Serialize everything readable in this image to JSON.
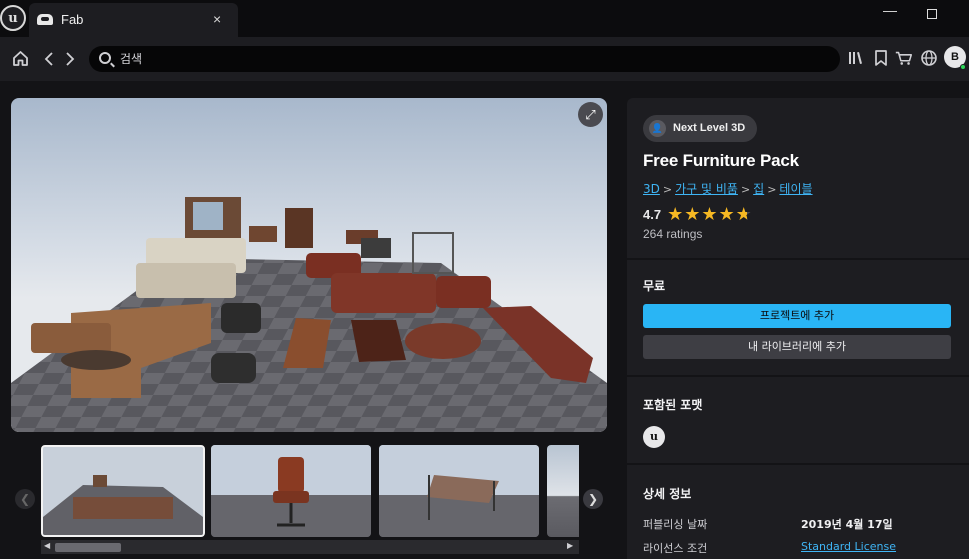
{
  "titlebar": {
    "app_logo": "u",
    "tab_title": "Fab",
    "tab_close": "×",
    "minimize": "—"
  },
  "toolbar": {
    "search_placeholder": "검색",
    "avatar_initial": "B"
  },
  "product": {
    "seller": "Next Level 3D",
    "title": "Free Furniture Pack",
    "breadcrumbs": [
      "3D",
      "가구 및 비품",
      "집",
      "테이블"
    ],
    "rating": "4.7",
    "stars": 4.7,
    "ratings_count": "264 ratings"
  },
  "pricing": {
    "price": "무료",
    "add_to_project": "프로젝트에 추가",
    "add_to_library": "내 라이브러리에 추가"
  },
  "formats": {
    "label": "포함된 포맷",
    "engine_icon": "u"
  },
  "details": {
    "label": "상세 정보",
    "publish_date_label": "퍼블리싱 날짜",
    "publish_date": "2019년 4월 17일",
    "license_label": "라이선스 조건",
    "license": "Standard License"
  },
  "colors": {
    "accent": "#29b5f5",
    "link": "#3fb5f5",
    "star": "#f6b823",
    "panel": "#1d1d21",
    "background": "#131316"
  }
}
